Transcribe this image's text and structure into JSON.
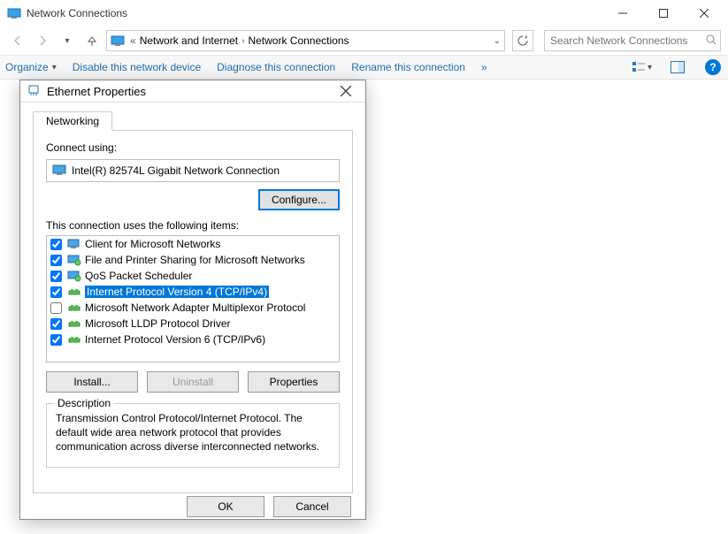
{
  "window": {
    "title": "Network Connections"
  },
  "breadcrumb": {
    "prefix": "«",
    "segments": [
      "Network and Internet",
      "Network Connections"
    ]
  },
  "search": {
    "placeholder": "Search Network Connections"
  },
  "toolbar": {
    "organize": "Organize",
    "disable": "Disable this network device",
    "diagnose": "Diagnose this connection",
    "rename": "Rename this connection",
    "overflow": "»"
  },
  "dialog": {
    "title": "Ethernet Properties",
    "tab": "Networking",
    "connect_using_label": "Connect using:",
    "adapter_name": "Intel(R) 82574L Gigabit Network Connection",
    "configure_btn": "Configure...",
    "items_label": "This connection uses the following items:",
    "items": [
      {
        "checked": true,
        "selected": false,
        "icon": "client",
        "name": "Client for Microsoft Networks"
      },
      {
        "checked": true,
        "selected": false,
        "icon": "service",
        "name": "File and Printer Sharing for Microsoft Networks"
      },
      {
        "checked": true,
        "selected": false,
        "icon": "service",
        "name": "QoS Packet Scheduler"
      },
      {
        "checked": true,
        "selected": true,
        "icon": "proto",
        "name": "Internet Protocol Version 4 (TCP/IPv4)"
      },
      {
        "checked": false,
        "selected": false,
        "icon": "proto",
        "name": "Microsoft Network Adapter Multiplexor Protocol"
      },
      {
        "checked": true,
        "selected": false,
        "icon": "proto",
        "name": "Microsoft LLDP Protocol Driver"
      },
      {
        "checked": true,
        "selected": false,
        "icon": "proto",
        "name": "Internet Protocol Version 6 (TCP/IPv6)"
      }
    ],
    "install_btn": "Install...",
    "uninstall_btn": "Uninstall",
    "properties_btn": "Properties",
    "desc_legend": "Description",
    "desc_text": "Transmission Control Protocol/Internet Protocol. The default wide area network protocol that provides communication across diverse interconnected networks.",
    "ok_btn": "OK",
    "cancel_btn": "Cancel"
  }
}
